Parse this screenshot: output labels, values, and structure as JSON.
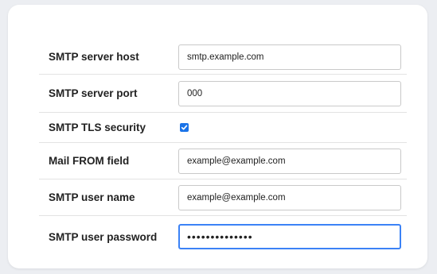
{
  "fields": {
    "host": {
      "label": "SMTP server host",
      "value": "smtp.example.com"
    },
    "port": {
      "label": "SMTP server port",
      "value": "000"
    },
    "tls": {
      "label": "SMTP TLS security",
      "checked": true
    },
    "from": {
      "label": "Mail FROM field",
      "value": "example@example.com"
    },
    "user": {
      "label": "SMTP user name",
      "value": "example@example.com"
    },
    "password": {
      "label": "SMTP user password",
      "value": "••••••••••••••"
    }
  },
  "colors": {
    "checkbox_accent": "#1a73e8",
    "focus_border": "#3b82f6"
  }
}
